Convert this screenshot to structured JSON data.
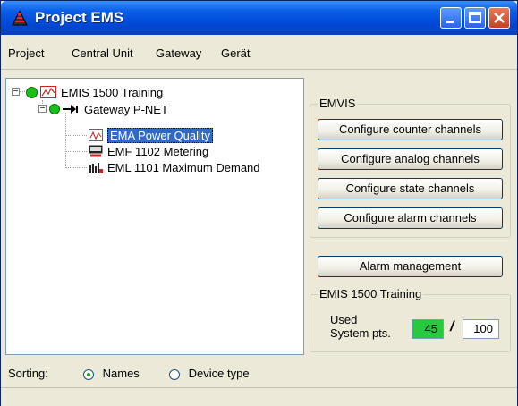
{
  "window": {
    "title": "Project EMS",
    "colors": {
      "titlebar": "#0a5ee8",
      "face": "#ece9d8",
      "selection": "#316ac5",
      "used_points_bg": "#27c93f"
    }
  },
  "menu": {
    "items": [
      {
        "label": "Project"
      },
      {
        "label": "Central Unit"
      },
      {
        "label": "Gateway"
      },
      {
        "label": "Gerät"
      }
    ]
  },
  "tree": {
    "root": {
      "label": "EMIS 1500 Training",
      "icon": "chart-icon"
    },
    "gateway": {
      "label": "Gateway P-NET",
      "icon": "gateway-arrow-icon"
    },
    "devices": [
      {
        "label": "EMA Power Quality",
        "icon": "power-quality-icon",
        "selected": true
      },
      {
        "label": "EMF 1102 Metering",
        "icon": "metering-icon",
        "selected": false
      },
      {
        "label": "EML 1101 Maximum Demand",
        "icon": "max-demand-icon",
        "selected": false
      }
    ]
  },
  "emvis": {
    "title": "EMVIS",
    "buttons": [
      {
        "label": "Configure counter channels"
      },
      {
        "label": "Configure analog channels"
      },
      {
        "label": "Configure state channels"
      },
      {
        "label": "Configure alarm channels"
      }
    ]
  },
  "alarm_button": {
    "label": "Alarm management"
  },
  "training_group": {
    "title": "EMIS 1500 Training",
    "used_label_line1": "Used",
    "used_label_line2": "System pts.",
    "used_value": "45",
    "separator": "/",
    "max_value": "100"
  },
  "sorting": {
    "label": "Sorting:",
    "options": [
      {
        "label": "Names",
        "checked": true
      },
      {
        "label": "Device type",
        "checked": false
      }
    ]
  }
}
